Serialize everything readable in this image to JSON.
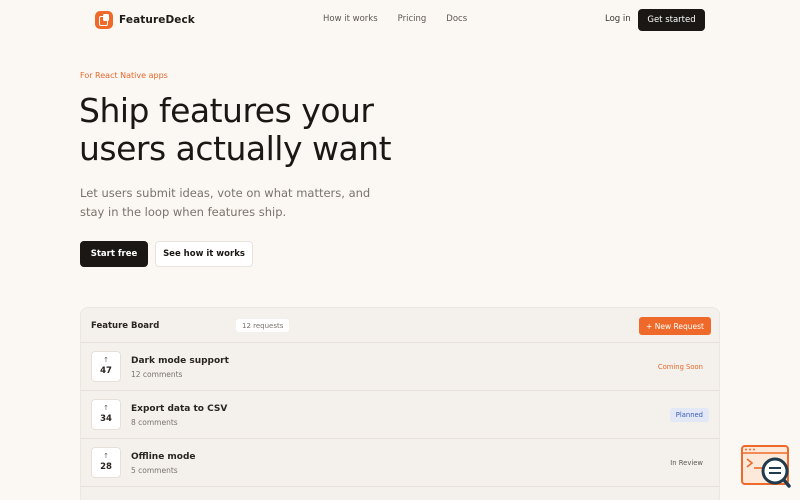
{
  "nav": {
    "brand": "FeatureDeck",
    "links": [
      "How it works",
      "Pricing",
      "Docs"
    ],
    "login": "Log in",
    "cta": "Get started"
  },
  "hero": {
    "eyebrow": "For React Native apps",
    "title_line1": "Ship features your",
    "title_line2": "users actually want",
    "subtitle": "Let users submit ideas, vote on what matters, and stay in the loop when features ship.",
    "primary_button": "Start free",
    "secondary_button": "See how it works"
  },
  "board": {
    "title": "Feature Board",
    "count": "12 requests",
    "new_button": "+ New Request",
    "rows": [
      {
        "votes": "47",
        "title": "Dark mode support",
        "comments": "12 comments",
        "status": "Coming Soon",
        "status_color": "#e8672b",
        "status_bg": "transparent"
      },
      {
        "votes": "34",
        "title": "Export data to CSV",
        "comments": "8 comments",
        "status": "Planned",
        "status_color": "#3b5bb3",
        "status_bg": "#e3e8f6"
      },
      {
        "votes": "28",
        "title": "Offline mode",
        "comments": "5 comments",
        "status": "In Review",
        "status_color": "#5c5650",
        "status_bg": "transparent"
      }
    ]
  },
  "colors": {
    "accent": "#ef6a2a",
    "dark": "#1a1714",
    "background": "#fbf8f4"
  },
  "icons": {
    "vote": "arrow-up-icon",
    "brand": "featuredeck-logo-icon",
    "help": "help-widget-icon"
  }
}
